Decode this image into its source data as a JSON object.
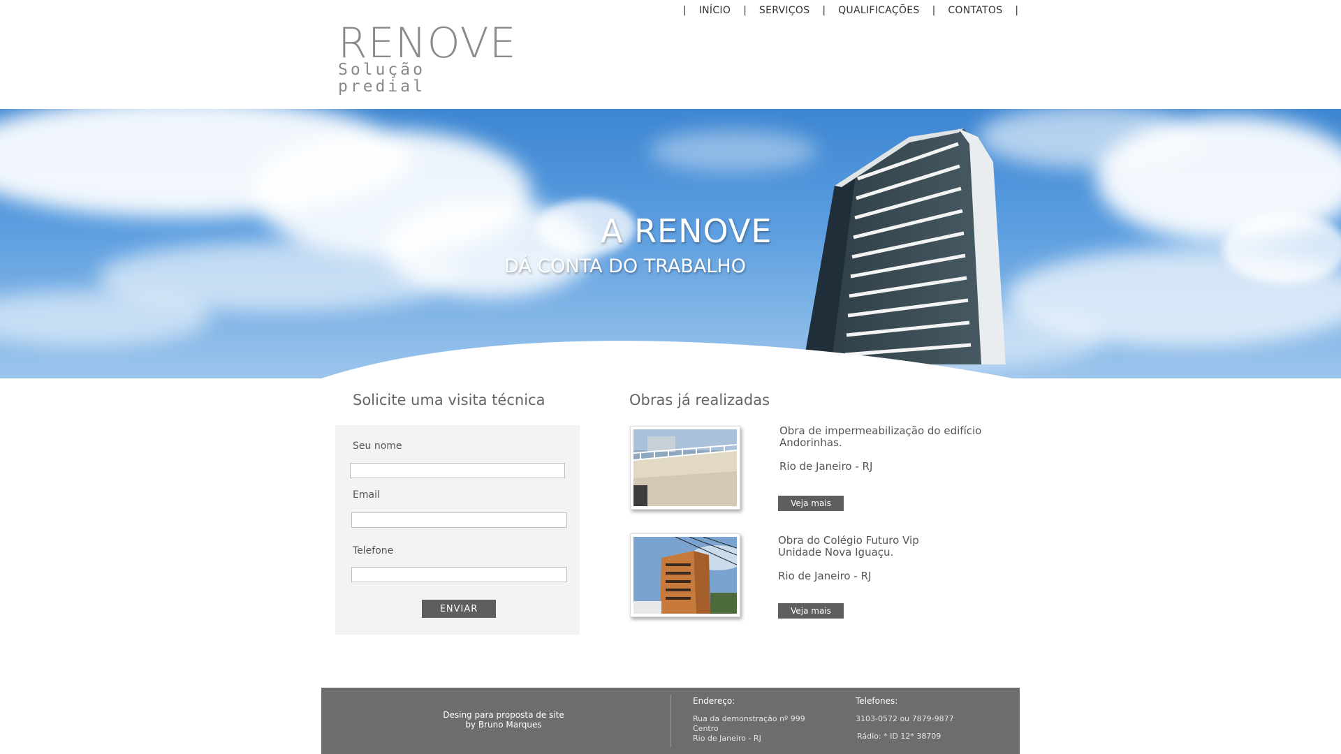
{
  "logo": {
    "title": "RENOVE",
    "subtitle": "Solução predial"
  },
  "nav": {
    "items": [
      "INÍCIO",
      "SERVIÇOS",
      "QUALIFICAÇÕES",
      "CONTATOS"
    ]
  },
  "hero": {
    "title": "A RENOVE",
    "subtitle": "DÁ CONTA DO TRABALHO"
  },
  "form": {
    "heading": "Solicite uma visita técnica",
    "name_label": "Seu nome",
    "email_label": "Email",
    "phone_label": "Telefone",
    "name_value": "",
    "email_value": "",
    "phone_value": "",
    "submit_label": "ENVIAR"
  },
  "works": {
    "heading": "Obras já realizadas",
    "items": [
      {
        "title": "Obra de impermeabilização do edifício Andorinhas.",
        "location": "Rio de Janeiro - RJ",
        "button": "Veja mais"
      },
      {
        "title": "Obra do Colégio Futuro Vip Unidade Nova Iguaçu.",
        "location": "Rio de Janeiro - RJ",
        "button": "Veja mais"
      }
    ]
  },
  "footer": {
    "credit_line1": "Desing para proposta de site",
    "credit_line2": "by Bruno Marques",
    "address_heading": "Endereço:",
    "address_line1": "Rua da demonstração nº 999",
    "address_line2": "Centro",
    "address_line3": "Rio de Janeiro - RJ",
    "phones_heading": "Telefones:",
    "phones_line1": "3103-0572 ou 7879-9877",
    "phones_line2": "Rádio: * ID 12* 38709"
  },
  "colors": {
    "button": "#5e5e5e",
    "footer": "#6d6d6d",
    "form_bg": "#f3f3f3",
    "sky": "#4a8fd8"
  }
}
